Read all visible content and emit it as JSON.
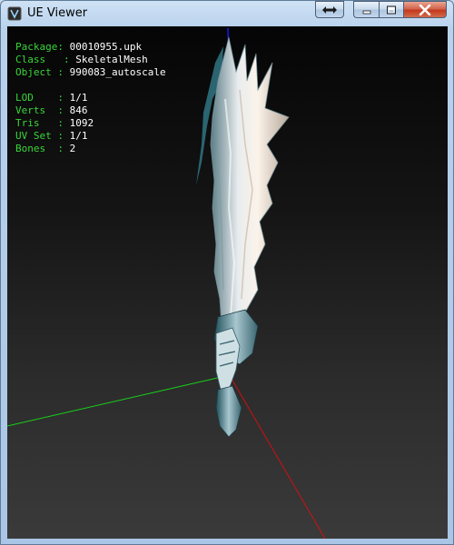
{
  "window": {
    "title": "UE Viewer",
    "accent_frame": "#b9d2ec",
    "close_color": "#c2391e"
  },
  "info": {
    "package_label": "Package",
    "package_value": "00010955.upk",
    "class_label": "Class",
    "class_value": "SkeletalMesh",
    "object_label": "Object",
    "object_value": "990083_autoscale",
    "lod_label": "LOD",
    "lod_value": "1/1",
    "verts_label": "Verts",
    "verts_value": "846",
    "tris_label": "Tris",
    "tris_value": "1092",
    "uvset_label": "UV Set",
    "uvset_value": "1/1",
    "bones_label": "Bones",
    "bones_value": "2",
    "label_color": "#3ad53a",
    "value_color": "#ffffff"
  },
  "axes": {
    "x_color": "#d01010",
    "y_color": "#18d018",
    "z_color": "#1a1aff"
  },
  "icons": {
    "app": "ue-viewer-app-icon",
    "extra": "swap-arrows-icon",
    "minimize": "minimize-icon",
    "maximize": "maximize-icon",
    "close": "close-icon"
  }
}
